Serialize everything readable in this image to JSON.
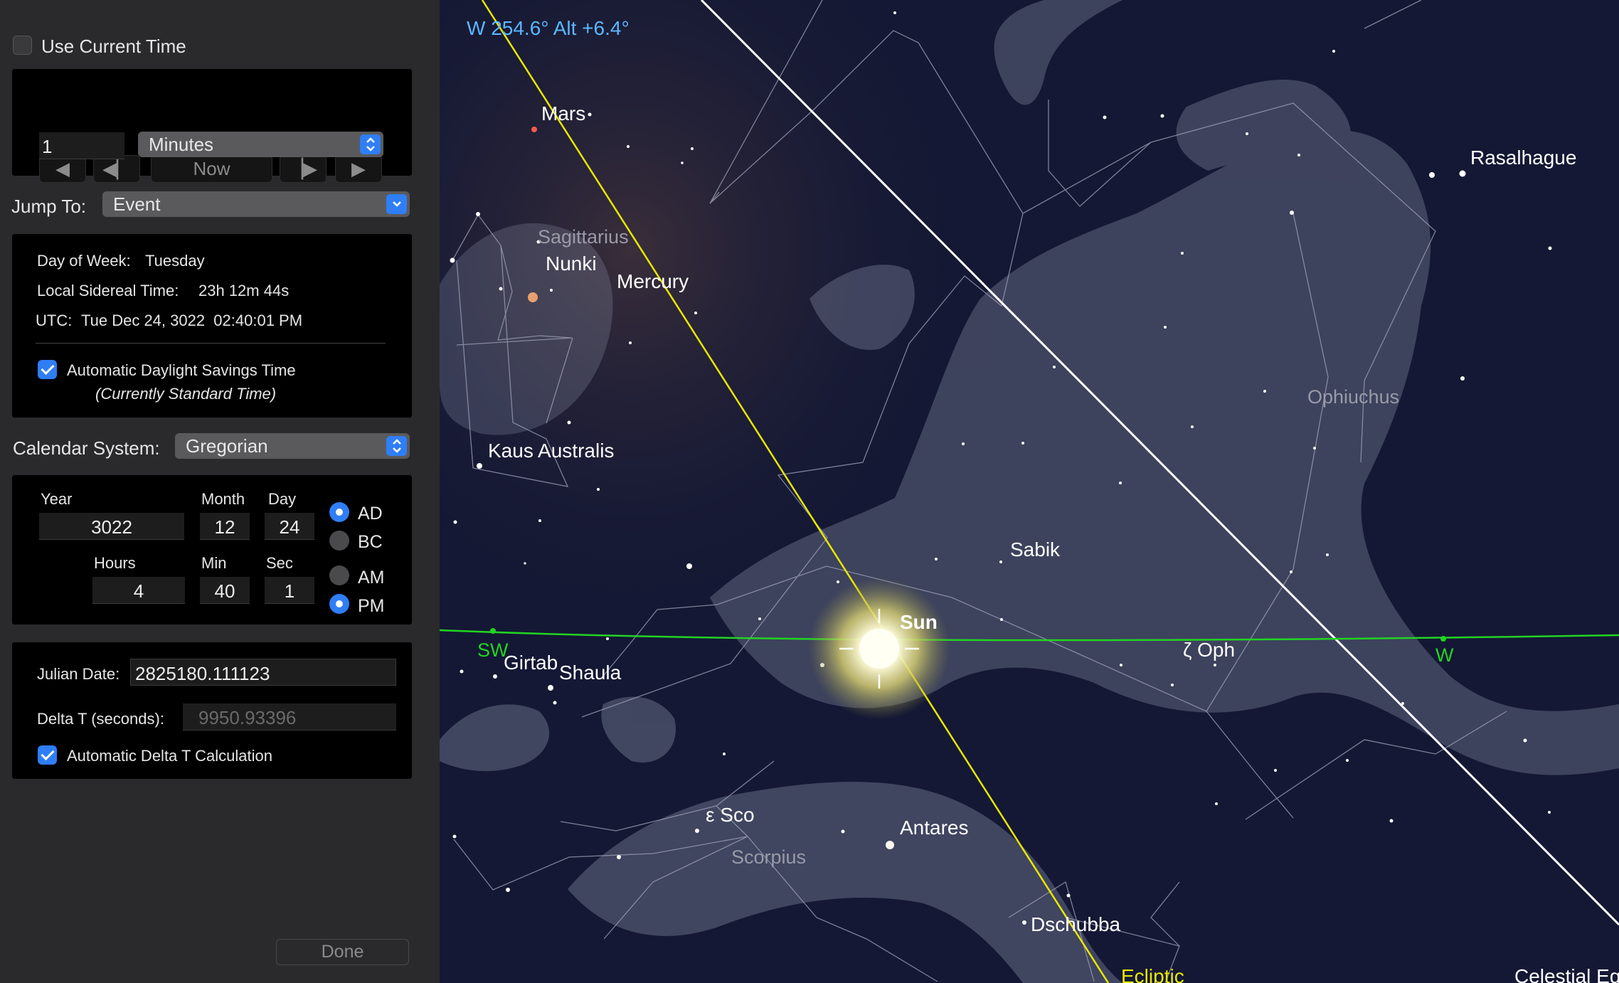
{
  "time_panel": {
    "use_current_time_label": "Use Current Time",
    "use_current_time_checked": false,
    "step_controls": {
      "now_label": "Now",
      "step_value": "1",
      "step_unit": "Minutes"
    },
    "jump_to": {
      "label": "Jump To:",
      "value": "Event"
    },
    "info": {
      "day_of_week_label": "Day of Week:",
      "day_of_week_value": "Tuesday",
      "sidereal_label": "Local Sidereal Time:",
      "sidereal_value": "23h 12m 44s",
      "utc_label": "UTC:",
      "utc_value": "Tue Dec 24, 3022  02:40:01 PM",
      "auto_dst_label": "Automatic Daylight Savings Time",
      "auto_dst_checked": true,
      "dst_status": "(Currently Standard Time)"
    },
    "calendar": {
      "label": "Calendar System:",
      "value": "Gregorian"
    },
    "date": {
      "year_label": "Year",
      "year": "3022",
      "month_label": "Month",
      "month": "12",
      "day_label": "Day",
      "day": "24",
      "hours_label": "Hours",
      "hours": "4",
      "min_label": "Min",
      "min": "40",
      "sec_label": "Sec",
      "sec": "1",
      "ad_label": "AD",
      "bc_label": "BC",
      "era_selected": "AD",
      "am_label": "AM",
      "pm_label": "PM",
      "meridiem_selected": "PM"
    },
    "julian": {
      "julian_date_label": "Julian Date:",
      "julian_date_value": "2825180.111123",
      "delta_t_label": "Delta T (seconds):",
      "delta_t_value": "9950.93396",
      "auto_delta_t_label": "Automatic Delta T Calculation",
      "auto_delta_t_checked": true
    },
    "done_label": "Done"
  },
  "sky": {
    "pointer_readout": "W 254.6° Alt +6.4°",
    "colors": {
      "horizon": "#22d422",
      "ecliptic": "#e8e800",
      "celestial_equator": "#ffffff",
      "readout": "#5ab8ff",
      "background": "#121631"
    },
    "constellations": [
      "Sagittarius",
      "Ophiuchus",
      "Scorpius"
    ],
    "objects": {
      "mars": "Mars",
      "nunki": "Nunki",
      "mercury": "Mercury",
      "kaus_australis": "Kaus Australis",
      "rasalhague": "Rasalhague",
      "sabik": "Sabik",
      "sun": "Sun",
      "zeta_oph": "ζ Oph",
      "girtab": "Girtab",
      "shaula": "Shaula",
      "epsilon_sco": "ε Sco",
      "antares": "Antares",
      "dschubba": "Dschubba"
    },
    "compass": {
      "sw": "SW",
      "w": "W"
    },
    "line_labels": {
      "ecliptic": "Ecliptic",
      "celestial_equator": "Celestial Eq"
    }
  }
}
